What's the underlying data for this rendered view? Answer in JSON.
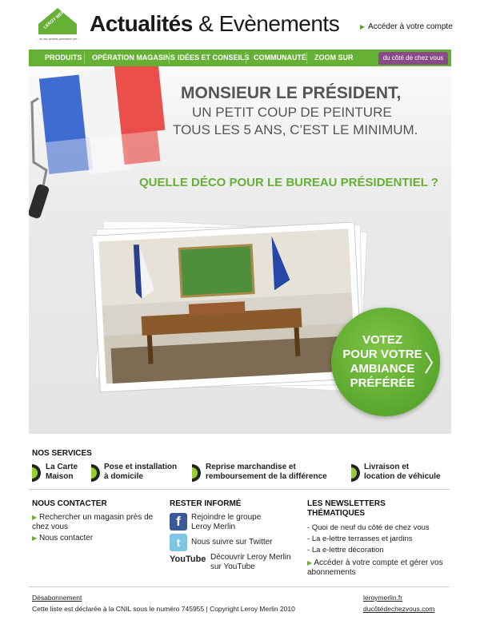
{
  "header": {
    "logo_text": "LEROY MERLIN",
    "logo_tagline": "...et vos envies prennent vie !",
    "title_bold": "Actualités",
    "title_rest": " & Evènements",
    "account_link": "Accéder à votre compte"
  },
  "nav": {
    "items": [
      "PRODUITS",
      "OPÉRATION MAGASINS",
      "IDÉES ET CONSEILS",
      "COMMUNAUTÉ",
      "ZOOM SUR"
    ],
    "chez_vous": "du côté de chez vous"
  },
  "hero": {
    "line1": "MONSIEUR LE PRÉSIDENT,",
    "line2": "UN PETIT COUP DE PEINTURE",
    "line3": "TOUS LES 5 ANS, C’EST LE MINIMUM.",
    "question": "QUELLE DÉCO POUR LE BUREAU PRÉSIDENTIEL ?",
    "vote_cta": [
      "VOTEZ",
      "POUR VOTRE",
      "AMBIANCE",
      "PRÉFÉRÉE"
    ]
  },
  "services": {
    "title": "NOS SERVICES",
    "items": [
      {
        "line1": "La Carte",
        "line2": "Maison"
      },
      {
        "line1": "Pose et installation",
        "line2": "à domicile"
      },
      {
        "line1": "Reprise marchandise et",
        "line2": "remboursement de la différence"
      },
      {
        "line1": "Livraison et",
        "line2": "location de véhicule"
      }
    ]
  },
  "contact": {
    "title": "NOUS CONTACTER",
    "items": [
      "Rechercher un magasin près de chez vous",
      "Nous contacter"
    ]
  },
  "informed": {
    "title": "RESTER INFORMÉ",
    "facebook": "Rejoindre le groupe Leroy Merlin",
    "twitter": "Nous suivre sur Twitter",
    "youtube_logo": "YouTube",
    "youtube": "Découvrir Leroy Merlin sur YouTube"
  },
  "newsletters": {
    "title": "LES NEWSLETTERS THÉMATIQUES",
    "items": [
      "Quoi de neuf du côté de chez vous",
      "La e-lettre terrasses et jardins",
      "La e-lettre décoration"
    ],
    "account": "Accéder à votre compte et gérer vos abonnements"
  },
  "footer": {
    "unsubscribe": "Désabonnement",
    "legal": "Cette liste est déclarée à la CNIL sous le numéro 745955 | Copyright Leroy Merlin 2010",
    "link1": "leroymerlin.fr",
    "link2": "ducôtédechezvous.com"
  },
  "colors": {
    "accent": "#66b036",
    "chez_vous": "#8a4a8a"
  }
}
